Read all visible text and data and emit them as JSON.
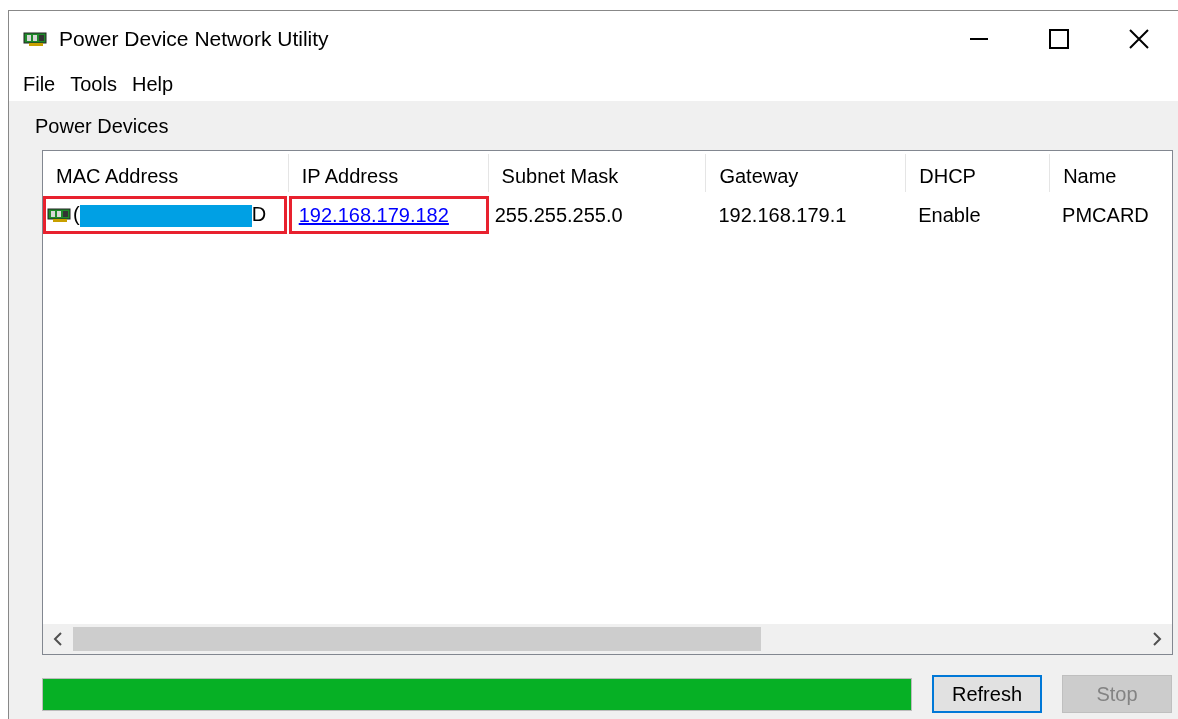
{
  "window": {
    "title": "Power Device Network Utility"
  },
  "menu": [
    "File",
    "Tools",
    "Help"
  ],
  "group": {
    "title": "Power Devices"
  },
  "table": {
    "columns": [
      "MAC Address",
      "IP Address",
      "Subnet Mask",
      "Gateway",
      "DHCP",
      "Name"
    ],
    "rows": [
      {
        "mac_prefix": "(",
        "mac_redacted": true,
        "mac_suffix": "D",
        "mac_highlighted": true,
        "ip": "192.168.179.182",
        "ip_highlighted": true,
        "subnet": "255.255.255.0",
        "gateway": "192.168.179.1",
        "dhcp": "Enable",
        "name": "PMCARD"
      }
    ]
  },
  "progress": {
    "level": 1
  },
  "buttons": [
    {
      "label": "Refresh",
      "focused": true,
      "disabled": false
    },
    {
      "label": "Stop",
      "focused": false,
      "disabled": true
    }
  ]
}
